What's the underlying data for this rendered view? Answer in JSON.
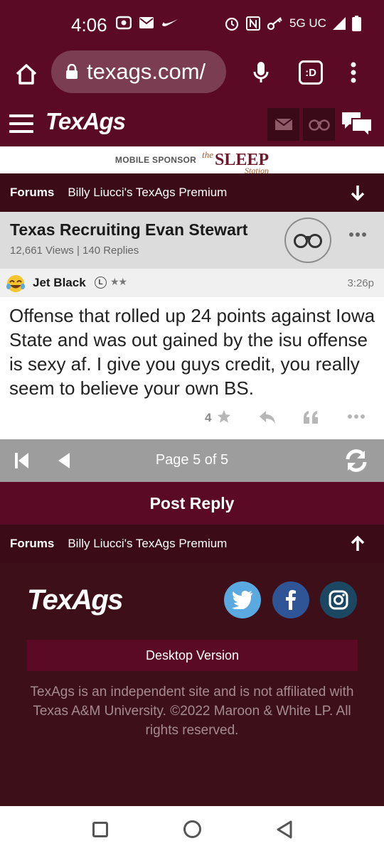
{
  "status_bar": {
    "time": "4:06",
    "network": "5G UC"
  },
  "browser": {
    "url": "texags.com/",
    "tab_icon_label": ":D"
  },
  "site": {
    "brand": "TexAgs"
  },
  "sponsor": {
    "label": "MOBILE SPONSOR",
    "brand_prefix": "the",
    "brand": "SLEEP",
    "brand_suffix": "Station"
  },
  "breadcrumb": {
    "forums": "Forums",
    "board": "Billy Liucci's TexAgs Premium"
  },
  "thread": {
    "title": "Texas Recruiting Evan Stewart",
    "meta": "12,661 Views | 140 Replies"
  },
  "post": {
    "username": "Jet Black",
    "badge": "L",
    "stars": "★★",
    "time": "3:26p",
    "body": "Offense that rolled up 24 points against Iowa State and was out gained by the isu offense is sexy af. I give you guys credit, you really seem to believe your own BS.",
    "likes": "4"
  },
  "pager": {
    "label": "Page 5 of 5"
  },
  "post_reply_label": "Post Reply",
  "footer": {
    "brand": "TexAgs",
    "desktop_label": "Desktop Version",
    "disclaimer": "TexAgs is an independent site and is not affiliated with Texas A&M University. ©2022 Maroon & White LP. All rights reserved."
  },
  "colors": {
    "maroon": "#5b0a25",
    "dark_maroon": "#3b0c17",
    "footer_bg": "#3d1019",
    "pager_gray": "#9d9d9d",
    "twitter": "#5aa9e0",
    "facebook": "#2f5596",
    "instagram": "#1c4763"
  }
}
